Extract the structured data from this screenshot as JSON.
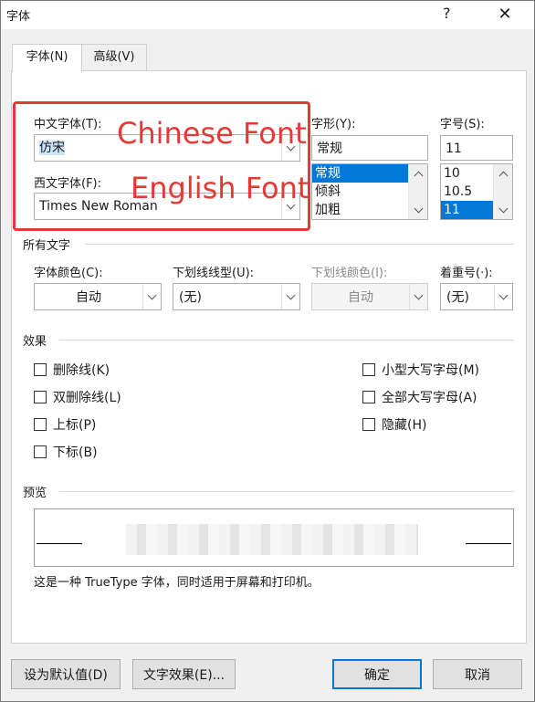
{
  "window": {
    "title": "字体",
    "help_label": "?",
    "close_label": "✕"
  },
  "tabs": [
    {
      "label": "字体(N)",
      "active": true
    },
    {
      "label": "高级(V)",
      "active": false
    }
  ],
  "chinese_font": {
    "label": "中文字体(T):",
    "value": "仿宋"
  },
  "western_font": {
    "label": "西文字体(F):",
    "value": "Times New Roman"
  },
  "style": {
    "label": "字形(Y):",
    "value": "常规",
    "options": [
      "常规",
      "倾斜",
      "加粗"
    ],
    "selected_index": 0
  },
  "size": {
    "label": "字号(S):",
    "value": "11",
    "options": [
      "10",
      "10.5",
      "11"
    ],
    "selected_index": 2
  },
  "all_text": {
    "section_label": "所有文字",
    "font_color": {
      "label": "字体颜色(C):",
      "value": "自动"
    },
    "underline_style": {
      "label": "下划线线型(U):",
      "value": "(无)"
    },
    "underline_color": {
      "label": "下划线颜色(I):",
      "value": "自动",
      "disabled": true
    },
    "emphasis": {
      "label": "着重号(·):",
      "value": "(无)"
    }
  },
  "effects": {
    "section_label": "效果",
    "left": [
      {
        "label": "删除线(K)",
        "checked": false
      },
      {
        "label": "双删除线(L)",
        "checked": false
      },
      {
        "label": "上标(P)",
        "checked": false
      },
      {
        "label": "下标(B)",
        "checked": false
      }
    ],
    "right": [
      {
        "label": "小型大写字母(M)",
        "checked": false
      },
      {
        "label": "全部大写字母(A)",
        "checked": false
      },
      {
        "label": "隐藏(H)",
        "checked": false
      }
    ]
  },
  "preview": {
    "section_label": "预览",
    "note": "这是一种 TrueType 字体，同时适用于屏幕和打印机。"
  },
  "buttons": {
    "set_default": "设为默认值(D)",
    "text_effects": "文字效果(E)...",
    "ok": "确定",
    "cancel": "取消"
  },
  "annotations": {
    "chinese_font": "Chinese Font",
    "english_font": "English Font",
    "color": "#e53935"
  }
}
